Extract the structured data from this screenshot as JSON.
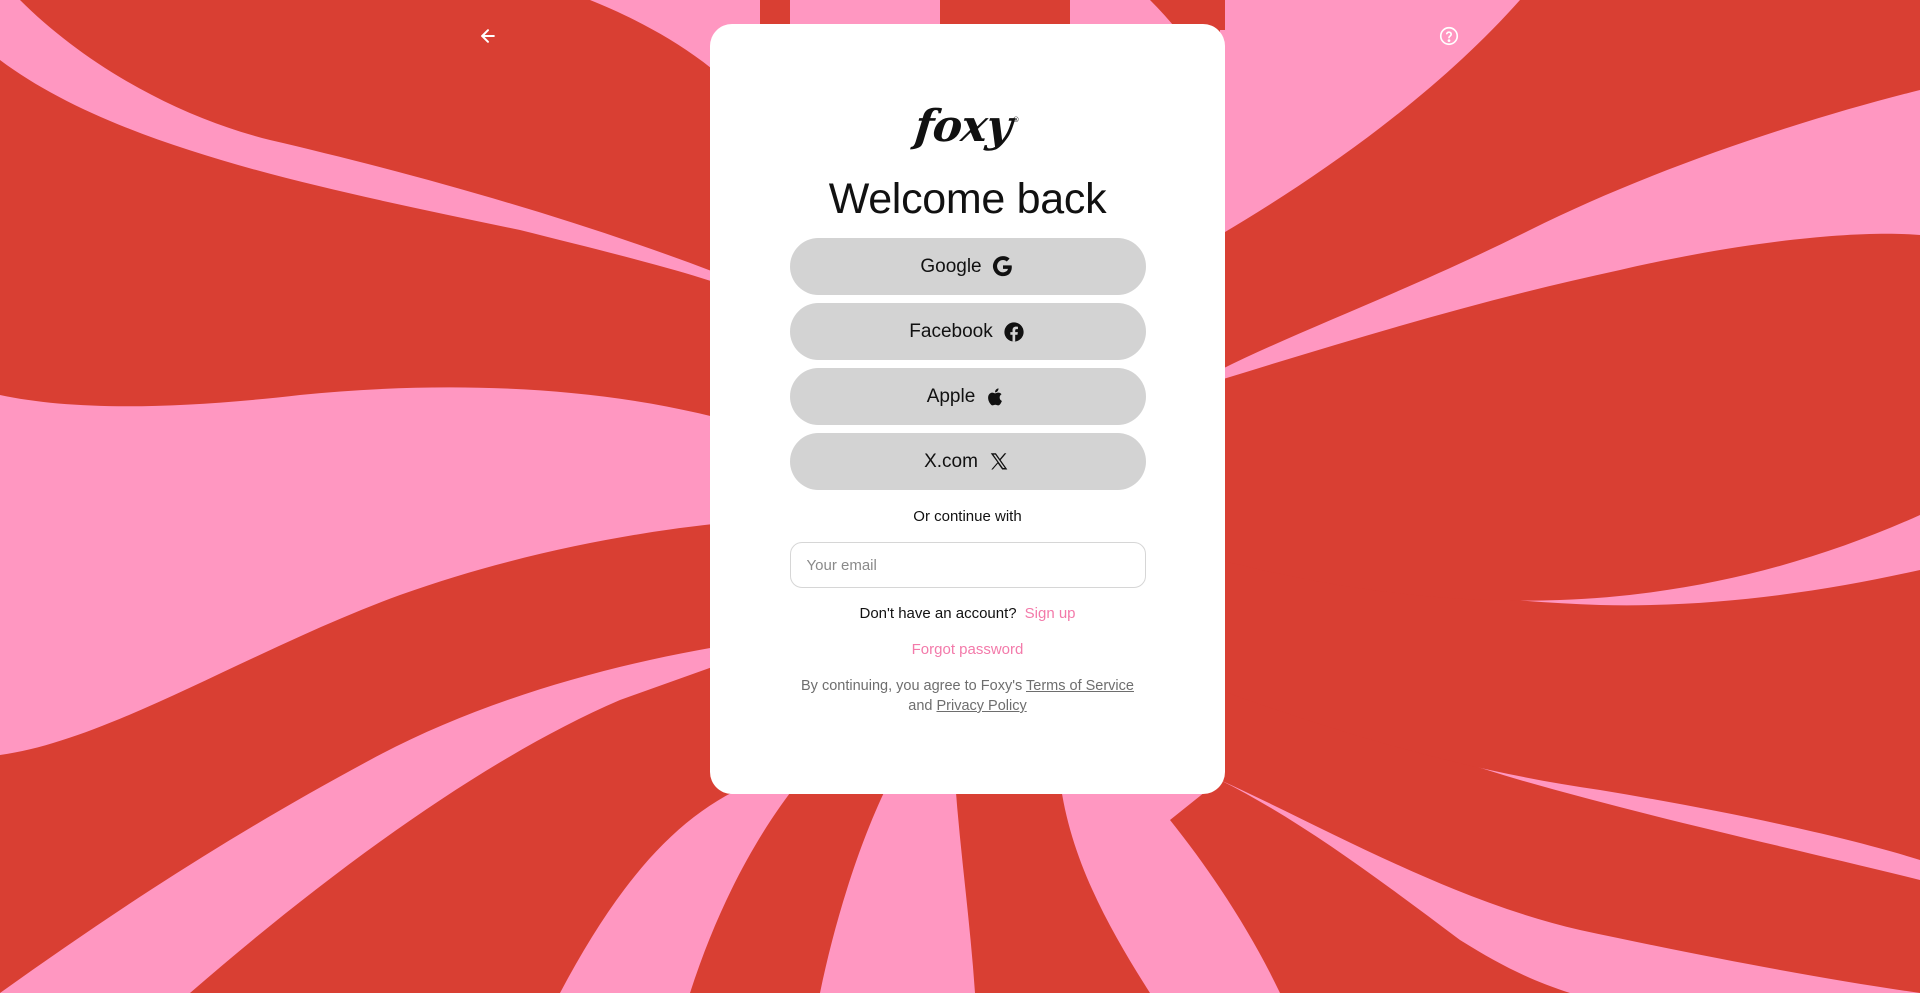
{
  "app": {
    "brand": "foxy",
    "brand_mark": "®"
  },
  "colors": {
    "background_red": "#D93F33",
    "background_pink": "#FF97C1",
    "card_bg": "#FFFFFF",
    "button_bg": "#D3D3D3",
    "accent_link": "#F37AAA"
  },
  "nav": {
    "back_icon": "arrow-left-icon",
    "help_icon": "help-circle-icon"
  },
  "login": {
    "title": "Welcome back",
    "providers": [
      {
        "label": "Google",
        "icon": "google-icon"
      },
      {
        "label": "Facebook",
        "icon": "facebook-icon"
      },
      {
        "label": "Apple",
        "icon": "apple-icon"
      },
      {
        "label": "X.com",
        "icon": "x-icon"
      }
    ],
    "divider_text": "Or continue with",
    "email": {
      "value": "",
      "placeholder": "Your email"
    },
    "signup_prompt": "Don't have an account?",
    "signup_link": "Sign up",
    "forgot_link": "Forgot password",
    "legal": {
      "prefix": "By continuing, you agree to Foxy's",
      "terms": "Terms of Service",
      "and": "and",
      "privacy": "Privacy Policy"
    }
  }
}
